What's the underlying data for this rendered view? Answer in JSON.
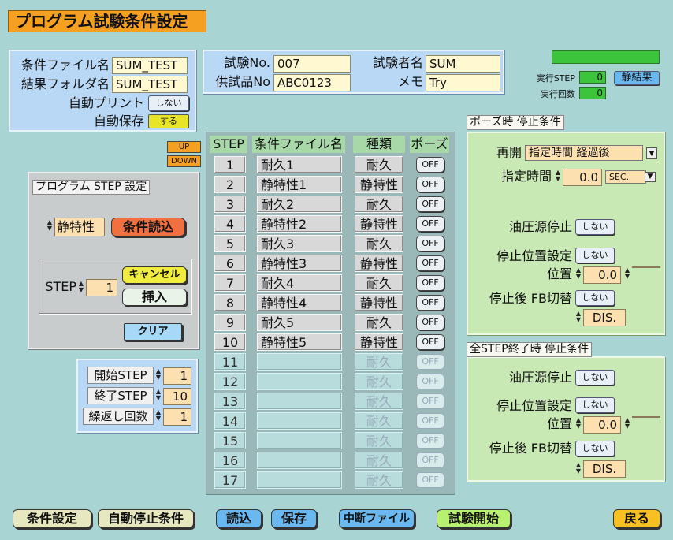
{
  "title": "プログラム試験条件設定",
  "cond": {
    "file_label": "条件ファイル名",
    "file_value": "SUM_TEST",
    "folder_label": "結果フォルダ名",
    "folder_value": "SUM_TEST",
    "autoprint_label": "自動プリント",
    "autoprint_value": "しない",
    "autosave_label": "自動保存",
    "autosave_value": "する"
  },
  "test": {
    "no_label": "試験No.",
    "no_value": "007",
    "tester_label": "試験者名",
    "tester_value": "SUM",
    "sample_label": "供試品No",
    "sample_value": "ABC0123",
    "memo_label": "メモ",
    "memo_value": "Try"
  },
  "status": {
    "step_label": "実行STEP",
    "step_value": "0",
    "count_label": "実行回数",
    "count_value": "0",
    "static_button": "静結果"
  },
  "updown": {
    "up": "UP",
    "down": "DOWN"
  },
  "step_panel": {
    "title": "プログラム STEP 設定",
    "type_value": "静特性",
    "load_button": "条件読込",
    "step_label": "STEP",
    "step_value": "1",
    "cancel_button": "キャンセル",
    "insert_button": "挿入",
    "clear_button": "クリア"
  },
  "range": {
    "start_label": "開始STEP",
    "start_value": "1",
    "end_label": "終了STEP",
    "end_value": "10",
    "repeat_label": "繰返し回数",
    "repeat_value": "1"
  },
  "table": {
    "headers": [
      "STEP",
      "条件ファイル名",
      "種類",
      "ポーズ"
    ],
    "rows": [
      {
        "step": "1",
        "file": "耐久1",
        "type": "耐久",
        "pause": "OFF"
      },
      {
        "step": "2",
        "file": "静特性1",
        "type": "静特性",
        "pause": "OFF"
      },
      {
        "step": "3",
        "file": "耐久2",
        "type": "耐久",
        "pause": "OFF"
      },
      {
        "step": "4",
        "file": "静特性2",
        "type": "静特性",
        "pause": "OFF"
      },
      {
        "step": "5",
        "file": "耐久3",
        "type": "耐久",
        "pause": "OFF"
      },
      {
        "step": "6",
        "file": "静特性3",
        "type": "静特性",
        "pause": "OFF"
      },
      {
        "step": "7",
        "file": "耐久4",
        "type": "耐久",
        "pause": "OFF"
      },
      {
        "step": "8",
        "file": "静特性4",
        "type": "静特性",
        "pause": "OFF"
      },
      {
        "step": "9",
        "file": "耐久5",
        "type": "耐久",
        "pause": "OFF"
      },
      {
        "step": "10",
        "file": "静特性5",
        "type": "静特性",
        "pause": "OFF"
      },
      {
        "step": "11",
        "file": "",
        "type": "耐久",
        "pause": "OFF"
      },
      {
        "step": "12",
        "file": "",
        "type": "耐久",
        "pause": "OFF"
      },
      {
        "step": "13",
        "file": "",
        "type": "耐久",
        "pause": "OFF"
      },
      {
        "step": "14",
        "file": "",
        "type": "耐久",
        "pause": "OFF"
      },
      {
        "step": "15",
        "file": "",
        "type": "耐久",
        "pause": "OFF"
      },
      {
        "step": "16",
        "file": "",
        "type": "耐久",
        "pause": "OFF"
      },
      {
        "step": "17",
        "file": "",
        "type": "耐久",
        "pause": "OFF"
      }
    ]
  },
  "pause": {
    "title": "ポーズ時 停止条件",
    "resume_label": "再開",
    "resume_value": "指定時間 経過後",
    "time_label": "指定時間",
    "time_value": "0.0",
    "time_unit": "SEC.",
    "oil_label": "油圧源停止",
    "oil_value": "しない",
    "stoppos_label": "停止位置設定",
    "stoppos_value": "しない",
    "pos_label": "位置",
    "pos_value": "0.0",
    "pos_value2": "",
    "fb_label": "停止後 FB切替",
    "fb_value": "しない",
    "fb_mode": "DIS."
  },
  "allend": {
    "title": "全STEP終了時 停止条件",
    "oil_label": "油圧源停止",
    "oil_value": "しない",
    "stoppos_label": "停止位置設定",
    "stoppos_value": "しない",
    "pos_label": "位置",
    "pos_value": "0.0",
    "pos_value2": "",
    "fb_label": "停止後 FB切替",
    "fb_value": "しない",
    "fb_mode": "DIS."
  },
  "bottom": {
    "cond_button": "条件設定",
    "autostop_button": "自動停止条件",
    "read_button": "読込",
    "save_button": "保存",
    "interrupt_button": "中断ファイル",
    "start_button": "試験開始",
    "back_button": "戻る"
  },
  "colors": {
    "title_bg": "#f5a020",
    "green_panel": "#c8e8b4",
    "blue_panel": "#b8d8f5",
    "background": "#a8d4d4"
  }
}
